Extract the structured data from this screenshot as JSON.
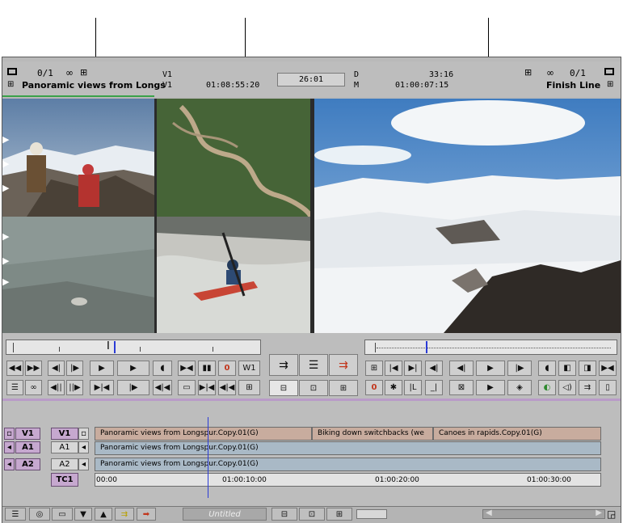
{
  "source_monitor": {
    "counter": "0/1",
    "clip_name": "Panoramic views from Longs",
    "track_top": "V1",
    "track_bottom": "V1",
    "timecode": "01:08:55:20"
  },
  "center": {
    "duration": "26:01"
  },
  "record_monitor": {
    "label_top": "D",
    "label_bottom": "M",
    "duration": "33:16",
    "timecode": "01:00:07:15",
    "counter": "0/1",
    "sequence_name": "Finish Line"
  },
  "source_buttons": {
    "row1": [
      "◀◀",
      "▶▶",
      "◀|",
      "|▶",
      "▶",
      "▶",
      "◖",
      "▶◀",
      "▮▮",
      "0",
      "W1"
    ],
    "row2": [
      "☰",
      "∞",
      "◀||",
      "||▶",
      "▶|◀",
      "|▶",
      "◀|◀",
      "▭",
      "▶|◀",
      "◀|◀",
      "⊞"
    ]
  },
  "center_buttons": {
    "row1": [
      "⇉",
      "☰",
      "⇉"
    ],
    "row2": [
      "⊟",
      "⊡",
      "⊞"
    ]
  },
  "record_buttons": {
    "row1": [
      "⊞",
      "|◀",
      "▶|",
      "◀|",
      "◀|",
      "▶",
      "|▶",
      "◖",
      "◧",
      "◨",
      "▶◀"
    ],
    "row2": [
      "0",
      "✱",
      "|L",
      "_|",
      "⊠",
      "▶",
      "◈",
      "◐",
      "◁)",
      "⇉",
      "▯"
    ]
  },
  "timeline": {
    "tracks": [
      {
        "source": "V1",
        "record": "V1"
      },
      {
        "source": "A1",
        "record": "A1"
      },
      {
        "source": "A2",
        "record": "A2"
      }
    ],
    "tc_track": "TC1",
    "v1_clips": [
      "Panoramic views from Longspur.Copy.01(G)",
      "Biking down switchbacks (we",
      "Canoes in rapids.Copy.01(G)"
    ],
    "a1_clip": "Panoramic views from Longspur.Copy.01(G)",
    "a2_clip": "Panoramic views from Longspur.Copy.01(G)",
    "tc_labels": [
      "00:00",
      "01:00:10:00",
      "01:00:20:00",
      "01:00:30:00"
    ]
  },
  "bottom_bar": {
    "title": "Untitled"
  },
  "colors": {
    "panel": "#bdbdbd",
    "accent_green": "#3aa24a",
    "track_purple": "#c6a8cf",
    "video_clip": "#c8ac9e",
    "audio_clip": "#a9b9c6",
    "playhead_blue": "#2b3bd6"
  }
}
